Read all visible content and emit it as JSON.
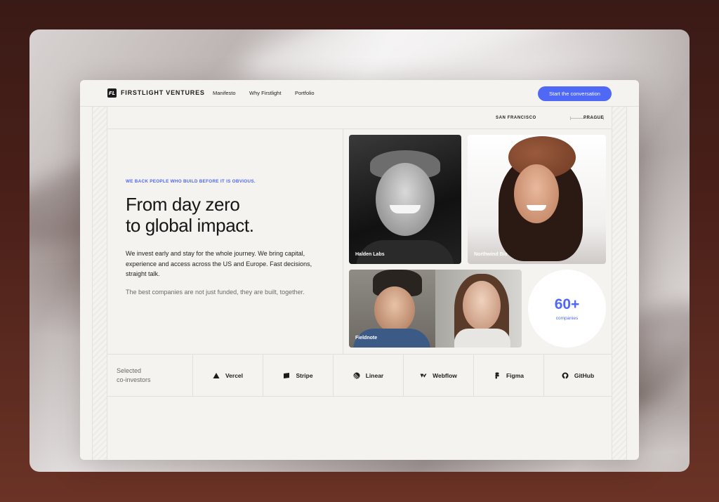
{
  "brand": {
    "name": "FIRSTLIGHT VENTURES",
    "mark": "FL"
  },
  "nav": {
    "links": [
      "Manifesto",
      "Why Firstlight",
      "Portfolio"
    ],
    "cta": "Start the conversation"
  },
  "locations": {
    "from": "SAN FRANCISCO",
    "to": "PRAGUE"
  },
  "hero": {
    "eyebrow": "WE BACK PEOPLE WHO BUILD BEFORE IT IS OBVIOUS.",
    "headline_line1": "From day zero",
    "headline_line2": "to global impact.",
    "body": "We invest early and stay for the whole journey. We bring capital, experience and access across the US and Europe. Fast decisions, straight talk.",
    "tagline": "The best companies are not just funded, they are built, together."
  },
  "portfolio": [
    {
      "label": "Halden Labs"
    },
    {
      "label": "Northwind Bio"
    },
    {
      "label": "Fieldnote"
    }
  ],
  "stat": {
    "value": "60+",
    "label": "companies"
  },
  "coinvestors": {
    "label_line1": "Selected",
    "label_line2": "co-investors",
    "items": [
      {
        "name": "Vercel",
        "icon": "vercel-icon"
      },
      {
        "name": "Stripe",
        "icon": "stripe-icon"
      },
      {
        "name": "Linear",
        "icon": "linear-icon"
      },
      {
        "name": "Webflow",
        "icon": "webflow-icon"
      },
      {
        "name": "Figma",
        "icon": "figma-icon"
      },
      {
        "name": "GitHub",
        "icon": "github-icon"
      }
    ]
  },
  "colors": {
    "accent": "#4f68f6",
    "background": "#f4f3ef",
    "ink": "#161616"
  }
}
